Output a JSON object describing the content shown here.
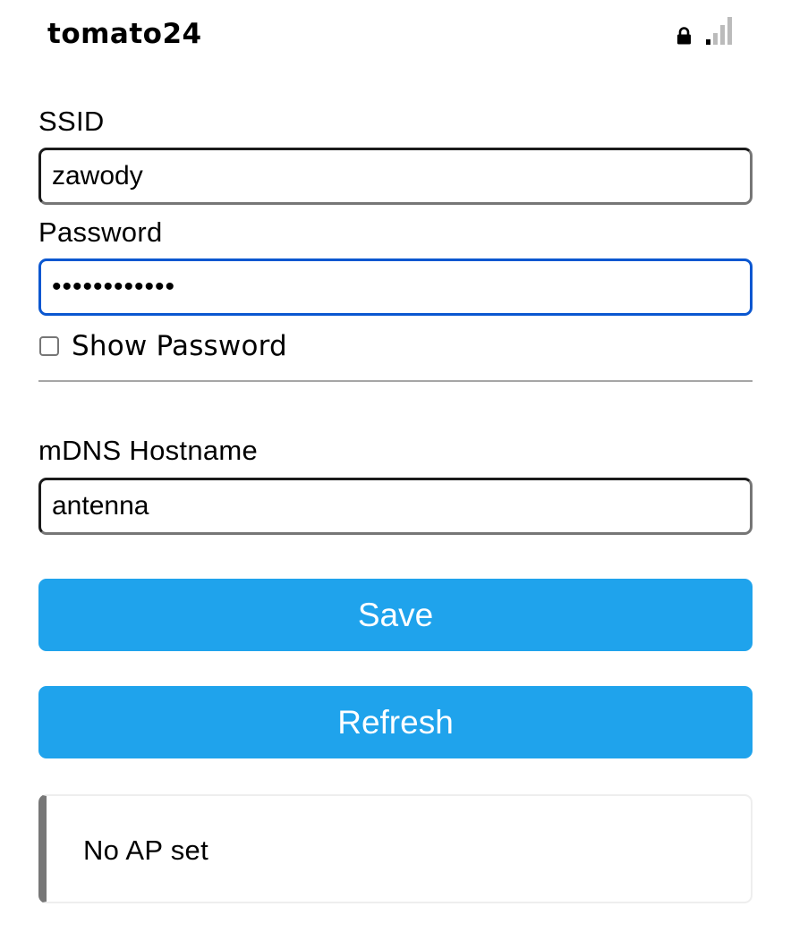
{
  "network": {
    "ssid_name": "tomato24",
    "lock_icon": "lock-icon",
    "signal_icon": "signal-strength-icon"
  },
  "form": {
    "ssid_label": "SSID",
    "ssid_value": "zawody",
    "password_label": "Password",
    "password_value": "••••••••••••",
    "show_password_label": "Show Password",
    "show_password_checked": false,
    "mdns_label": "mDNS Hostname",
    "mdns_value": "antenna"
  },
  "buttons": {
    "save_label": "Save",
    "refresh_label": "Refresh",
    "color": "#1fa3ec"
  },
  "status": {
    "message": "No AP set"
  },
  "colors": {
    "focus_border": "#0b57d0",
    "message_accent": "#777777"
  }
}
